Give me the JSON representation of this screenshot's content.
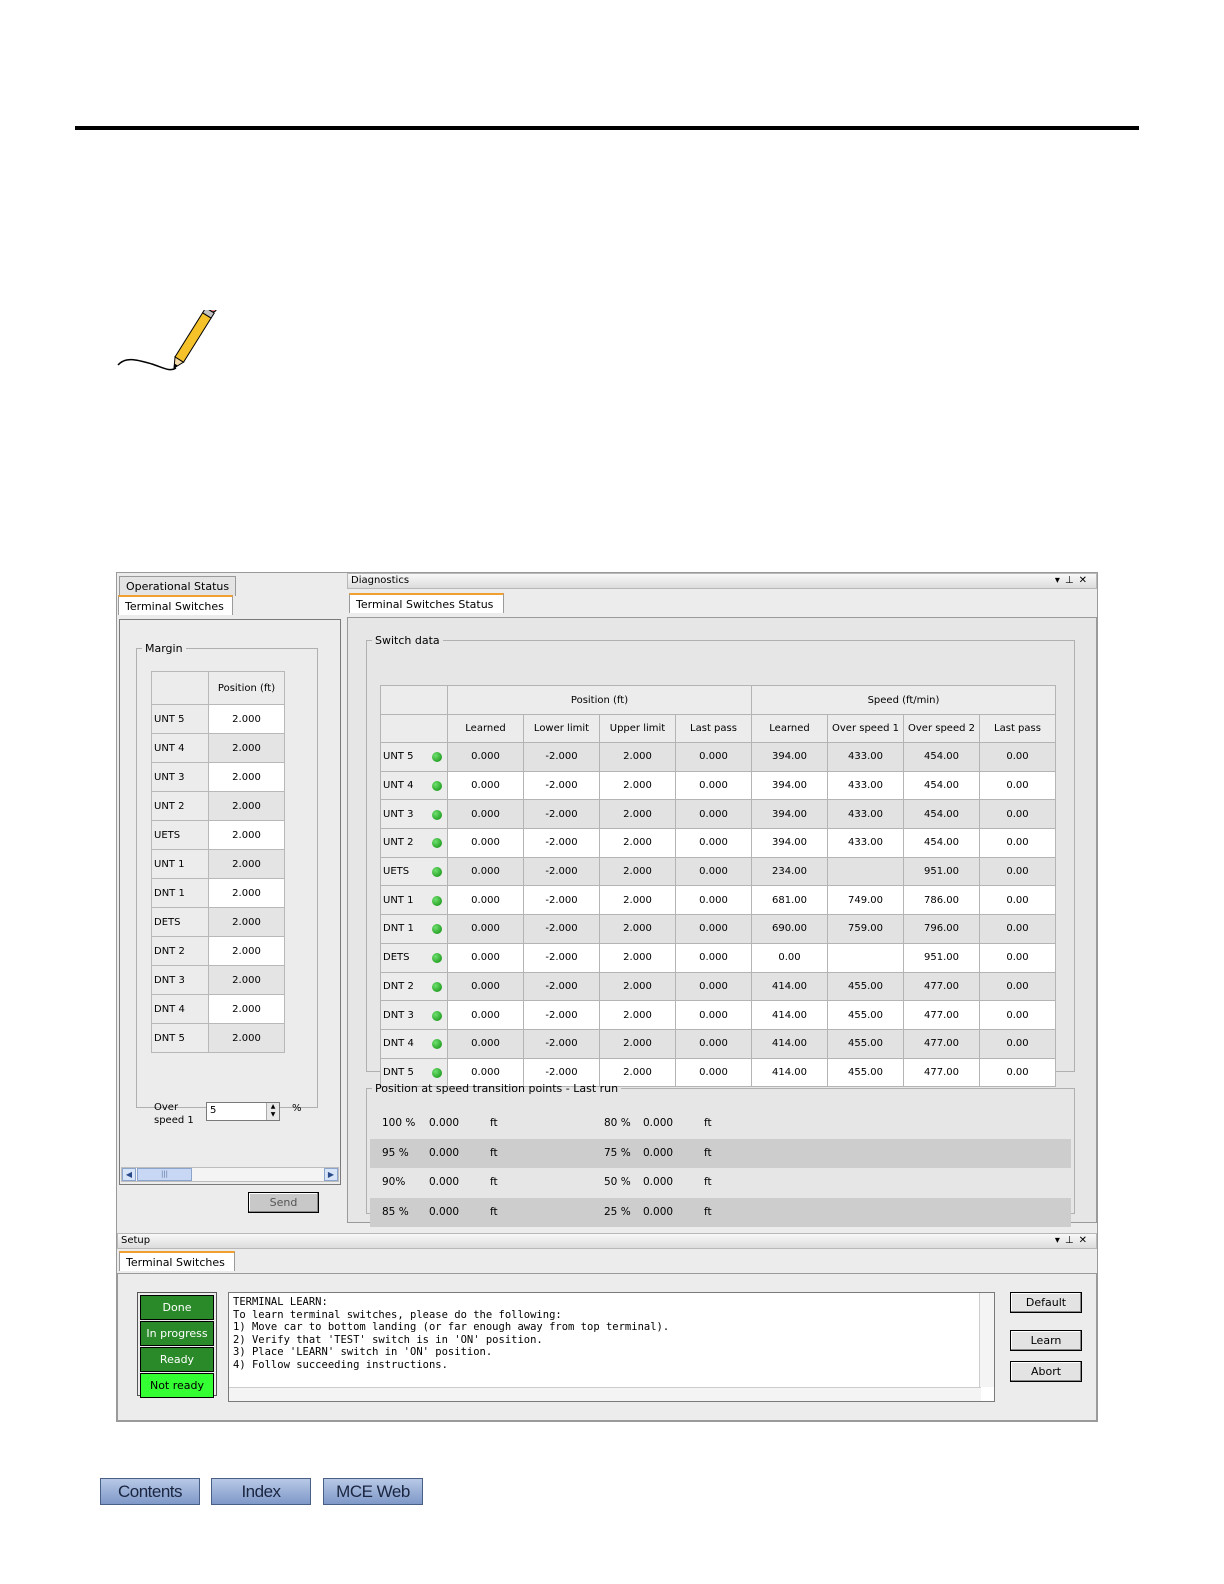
{
  "left_pane": {
    "tabs": [
      "Operational Status",
      "Terminal Switches"
    ],
    "margin": {
      "legend": "Margin",
      "column_header": "Position (ft)",
      "rows": [
        {
          "name": "UNT 5",
          "value": "2.000"
        },
        {
          "name": "UNT 4",
          "value": "2.000"
        },
        {
          "name": "UNT 3",
          "value": "2.000"
        },
        {
          "name": "UNT 2",
          "value": "2.000"
        },
        {
          "name": "UETS",
          "value": "2.000"
        },
        {
          "name": "UNT 1",
          "value": "2.000"
        },
        {
          "name": "DNT 1",
          "value": "2.000"
        },
        {
          "name": "DETS",
          "value": "2.000"
        },
        {
          "name": "DNT 2",
          "value": "2.000"
        },
        {
          "name": "DNT 3",
          "value": "2.000"
        },
        {
          "name": "DNT 4",
          "value": "2.000"
        },
        {
          "name": "DNT 5",
          "value": "2.000"
        }
      ],
      "over_speed_label_1": "Over",
      "over_speed_label_2": "speed 1",
      "over_speed_value": "5",
      "percent_sign": "%"
    },
    "send_label": "Send"
  },
  "diagnostics": {
    "title": "Diagnostics",
    "tab": "Terminal Switches Status",
    "switch_data_legend": "Switch data",
    "group_headers": [
      "Position (ft)",
      "Speed (ft/min)"
    ],
    "sub_headers": [
      "Learned",
      "Lower limit",
      "Upper limit",
      "Last pass",
      "Learned",
      "Over speed 1",
      "Over speed 2",
      "Last pass"
    ],
    "rows": [
      {
        "name": "UNT 5",
        "cells": [
          "0.000",
          "-2.000",
          "2.000",
          "0.000",
          "394.00",
          "433.00",
          "454.00",
          "0.00"
        ]
      },
      {
        "name": "UNT 4",
        "cells": [
          "0.000",
          "-2.000",
          "2.000",
          "0.000",
          "394.00",
          "433.00",
          "454.00",
          "0.00"
        ]
      },
      {
        "name": "UNT 3",
        "cells": [
          "0.000",
          "-2.000",
          "2.000",
          "0.000",
          "394.00",
          "433.00",
          "454.00",
          "0.00"
        ]
      },
      {
        "name": "UNT 2",
        "cells": [
          "0.000",
          "-2.000",
          "2.000",
          "0.000",
          "394.00",
          "433.00",
          "454.00",
          "0.00"
        ]
      },
      {
        "name": "UETS",
        "cells": [
          "0.000",
          "-2.000",
          "2.000",
          "0.000",
          "234.00",
          "",
          "951.00",
          "0.00"
        ]
      },
      {
        "name": "UNT 1",
        "cells": [
          "0.000",
          "-2.000",
          "2.000",
          "0.000",
          "681.00",
          "749.00",
          "786.00",
          "0.00"
        ]
      },
      {
        "name": "DNT 1",
        "cells": [
          "0.000",
          "-2.000",
          "2.000",
          "0.000",
          "690.00",
          "759.00",
          "796.00",
          "0.00"
        ]
      },
      {
        "name": "DETS",
        "cells": [
          "0.000",
          "-2.000",
          "2.000",
          "0.000",
          "0.00",
          "",
          "951.00",
          "0.00"
        ]
      },
      {
        "name": "DNT 2",
        "cells": [
          "0.000",
          "-2.000",
          "2.000",
          "0.000",
          "414.00",
          "455.00",
          "477.00",
          "0.00"
        ]
      },
      {
        "name": "DNT 3",
        "cells": [
          "0.000",
          "-2.000",
          "2.000",
          "0.000",
          "414.00",
          "455.00",
          "477.00",
          "0.00"
        ]
      },
      {
        "name": "DNT 4",
        "cells": [
          "0.000",
          "-2.000",
          "2.000",
          "0.000",
          "414.00",
          "455.00",
          "477.00",
          "0.00"
        ]
      },
      {
        "name": "DNT 5",
        "cells": [
          "0.000",
          "-2.000",
          "2.000",
          "0.000",
          "414.00",
          "455.00",
          "477.00",
          "0.00"
        ]
      }
    ],
    "transition_legend": "Position at speed transition points - Last run",
    "transition_rows": [
      {
        "p1": "100 %",
        "v1": "0.000",
        "u1": "ft",
        "p2": "80 %",
        "v2": "0.000",
        "u2": "ft"
      },
      {
        "p1": "95 %",
        "v1": "0.000",
        "u1": "ft",
        "p2": "75 %",
        "v2": "0.000",
        "u2": "ft"
      },
      {
        "p1": "90%",
        "v1": "0.000",
        "u1": "ft",
        "p2": "50 %",
        "v2": "0.000",
        "u2": "ft"
      },
      {
        "p1": "85 %",
        "v1": "0.000",
        "u1": "ft",
        "p2": "25 %",
        "v2": "0.000",
        "u2": "ft"
      }
    ]
  },
  "setup": {
    "title": "Setup",
    "tab": "Terminal Switches",
    "status_items": [
      "Done",
      "In progress",
      "Ready",
      "Not ready"
    ],
    "log_lines": [
      "TERMINAL LEARN:",
      "To learn terminal switches, please do the following:",
      "1) Move car to bottom landing (or far enough away from top terminal).",
      "2) Verify that 'TEST' switch is in 'ON' position.",
      "3) Place 'LEARN' switch in 'ON' position.",
      "4) Follow succeeding instructions."
    ],
    "buttons": {
      "default": "Default",
      "learn": "Learn",
      "abort": "Abort"
    }
  },
  "footer_nav": [
    "Contents",
    "Index",
    "MCE Web"
  ]
}
